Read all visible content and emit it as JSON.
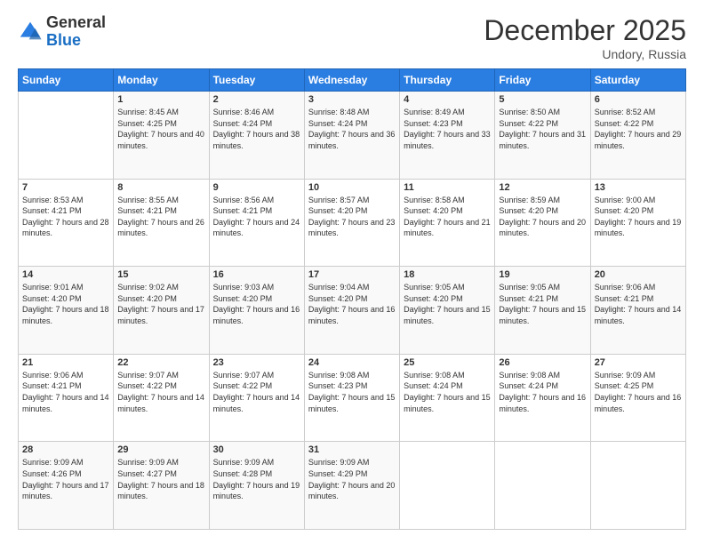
{
  "logo": {
    "general": "General",
    "blue": "Blue"
  },
  "header": {
    "month": "December 2025",
    "location": "Undory, Russia"
  },
  "days_of_week": [
    "Sunday",
    "Monday",
    "Tuesday",
    "Wednesday",
    "Thursday",
    "Friday",
    "Saturday"
  ],
  "weeks": [
    [
      {
        "day": "",
        "sunrise": "",
        "sunset": "",
        "daylight": ""
      },
      {
        "day": "1",
        "sunrise": "Sunrise: 8:45 AM",
        "sunset": "Sunset: 4:25 PM",
        "daylight": "Daylight: 7 hours and 40 minutes."
      },
      {
        "day": "2",
        "sunrise": "Sunrise: 8:46 AM",
        "sunset": "Sunset: 4:24 PM",
        "daylight": "Daylight: 7 hours and 38 minutes."
      },
      {
        "day": "3",
        "sunrise": "Sunrise: 8:48 AM",
        "sunset": "Sunset: 4:24 PM",
        "daylight": "Daylight: 7 hours and 36 minutes."
      },
      {
        "day": "4",
        "sunrise": "Sunrise: 8:49 AM",
        "sunset": "Sunset: 4:23 PM",
        "daylight": "Daylight: 7 hours and 33 minutes."
      },
      {
        "day": "5",
        "sunrise": "Sunrise: 8:50 AM",
        "sunset": "Sunset: 4:22 PM",
        "daylight": "Daylight: 7 hours and 31 minutes."
      },
      {
        "day": "6",
        "sunrise": "Sunrise: 8:52 AM",
        "sunset": "Sunset: 4:22 PM",
        "daylight": "Daylight: 7 hours and 29 minutes."
      }
    ],
    [
      {
        "day": "7",
        "sunrise": "Sunrise: 8:53 AM",
        "sunset": "Sunset: 4:21 PM",
        "daylight": "Daylight: 7 hours and 28 minutes."
      },
      {
        "day": "8",
        "sunrise": "Sunrise: 8:55 AM",
        "sunset": "Sunset: 4:21 PM",
        "daylight": "Daylight: 7 hours and 26 minutes."
      },
      {
        "day": "9",
        "sunrise": "Sunrise: 8:56 AM",
        "sunset": "Sunset: 4:21 PM",
        "daylight": "Daylight: 7 hours and 24 minutes."
      },
      {
        "day": "10",
        "sunrise": "Sunrise: 8:57 AM",
        "sunset": "Sunset: 4:20 PM",
        "daylight": "Daylight: 7 hours and 23 minutes."
      },
      {
        "day": "11",
        "sunrise": "Sunrise: 8:58 AM",
        "sunset": "Sunset: 4:20 PM",
        "daylight": "Daylight: 7 hours and 21 minutes."
      },
      {
        "day": "12",
        "sunrise": "Sunrise: 8:59 AM",
        "sunset": "Sunset: 4:20 PM",
        "daylight": "Daylight: 7 hours and 20 minutes."
      },
      {
        "day": "13",
        "sunrise": "Sunrise: 9:00 AM",
        "sunset": "Sunset: 4:20 PM",
        "daylight": "Daylight: 7 hours and 19 minutes."
      }
    ],
    [
      {
        "day": "14",
        "sunrise": "Sunrise: 9:01 AM",
        "sunset": "Sunset: 4:20 PM",
        "daylight": "Daylight: 7 hours and 18 minutes."
      },
      {
        "day": "15",
        "sunrise": "Sunrise: 9:02 AM",
        "sunset": "Sunset: 4:20 PM",
        "daylight": "Daylight: 7 hours and 17 minutes."
      },
      {
        "day": "16",
        "sunrise": "Sunrise: 9:03 AM",
        "sunset": "Sunset: 4:20 PM",
        "daylight": "Daylight: 7 hours and 16 minutes."
      },
      {
        "day": "17",
        "sunrise": "Sunrise: 9:04 AM",
        "sunset": "Sunset: 4:20 PM",
        "daylight": "Daylight: 7 hours and 16 minutes."
      },
      {
        "day": "18",
        "sunrise": "Sunrise: 9:05 AM",
        "sunset": "Sunset: 4:20 PM",
        "daylight": "Daylight: 7 hours and 15 minutes."
      },
      {
        "day": "19",
        "sunrise": "Sunrise: 9:05 AM",
        "sunset": "Sunset: 4:21 PM",
        "daylight": "Daylight: 7 hours and 15 minutes."
      },
      {
        "day": "20",
        "sunrise": "Sunrise: 9:06 AM",
        "sunset": "Sunset: 4:21 PM",
        "daylight": "Daylight: 7 hours and 14 minutes."
      }
    ],
    [
      {
        "day": "21",
        "sunrise": "Sunrise: 9:06 AM",
        "sunset": "Sunset: 4:21 PM",
        "daylight": "Daylight: 7 hours and 14 minutes."
      },
      {
        "day": "22",
        "sunrise": "Sunrise: 9:07 AM",
        "sunset": "Sunset: 4:22 PM",
        "daylight": "Daylight: 7 hours and 14 minutes."
      },
      {
        "day": "23",
        "sunrise": "Sunrise: 9:07 AM",
        "sunset": "Sunset: 4:22 PM",
        "daylight": "Daylight: 7 hours and 14 minutes."
      },
      {
        "day": "24",
        "sunrise": "Sunrise: 9:08 AM",
        "sunset": "Sunset: 4:23 PM",
        "daylight": "Daylight: 7 hours and 15 minutes."
      },
      {
        "day": "25",
        "sunrise": "Sunrise: 9:08 AM",
        "sunset": "Sunset: 4:24 PM",
        "daylight": "Daylight: 7 hours and 15 minutes."
      },
      {
        "day": "26",
        "sunrise": "Sunrise: 9:08 AM",
        "sunset": "Sunset: 4:24 PM",
        "daylight": "Daylight: 7 hours and 16 minutes."
      },
      {
        "day": "27",
        "sunrise": "Sunrise: 9:09 AM",
        "sunset": "Sunset: 4:25 PM",
        "daylight": "Daylight: 7 hours and 16 minutes."
      }
    ],
    [
      {
        "day": "28",
        "sunrise": "Sunrise: 9:09 AM",
        "sunset": "Sunset: 4:26 PM",
        "daylight": "Daylight: 7 hours and 17 minutes."
      },
      {
        "day": "29",
        "sunrise": "Sunrise: 9:09 AM",
        "sunset": "Sunset: 4:27 PM",
        "daylight": "Daylight: 7 hours and 18 minutes."
      },
      {
        "day": "30",
        "sunrise": "Sunrise: 9:09 AM",
        "sunset": "Sunset: 4:28 PM",
        "daylight": "Daylight: 7 hours and 19 minutes."
      },
      {
        "day": "31",
        "sunrise": "Sunrise: 9:09 AM",
        "sunset": "Sunset: 4:29 PM",
        "daylight": "Daylight: 7 hours and 20 minutes."
      },
      {
        "day": "",
        "sunrise": "",
        "sunset": "",
        "daylight": ""
      },
      {
        "day": "",
        "sunrise": "",
        "sunset": "",
        "daylight": ""
      },
      {
        "day": "",
        "sunrise": "",
        "sunset": "",
        "daylight": ""
      }
    ]
  ]
}
